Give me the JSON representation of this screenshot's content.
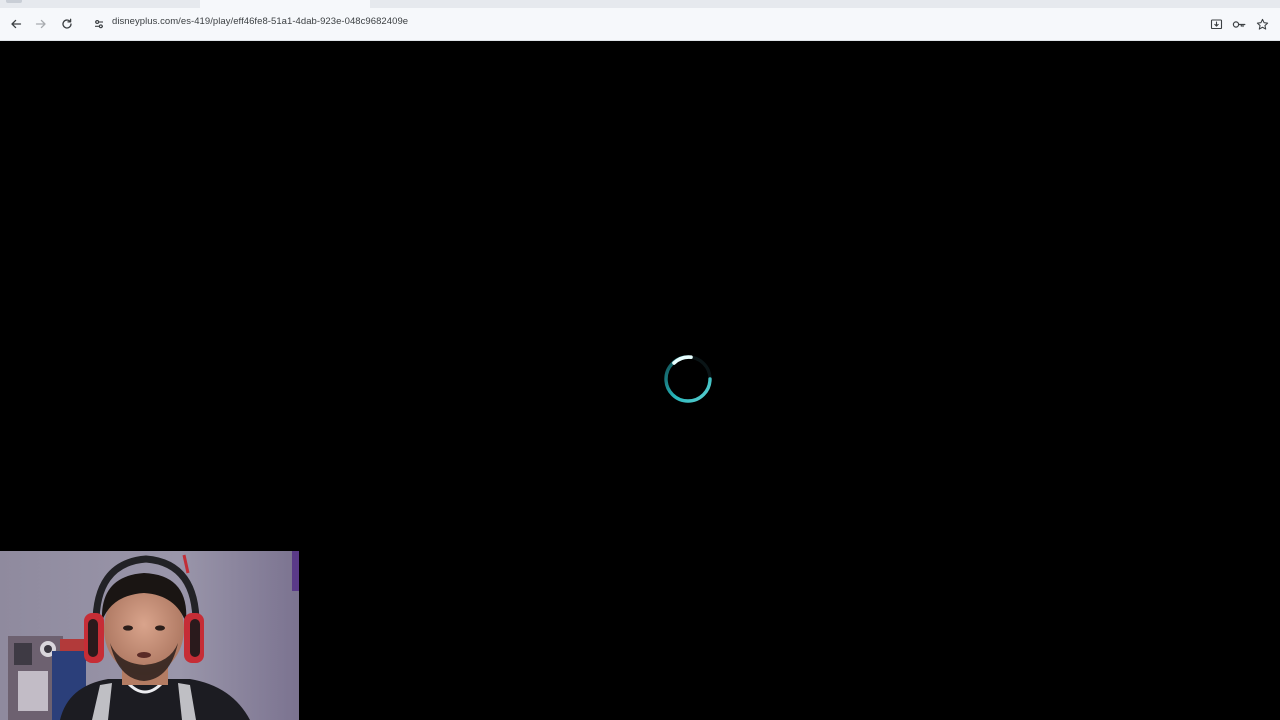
{
  "browser": {
    "url": "disneyplus.com/es-419/play/eff46fe8-51a1-4dab-923e-048c9682409e",
    "nav": {
      "back_icon": "arrow-left-icon",
      "forward_icon": "arrow-right-icon",
      "reload_icon": "reload-icon",
      "site_info_icon": "tune-icon"
    },
    "toolbar_right": {
      "install_icon": "install-app-icon",
      "password_icon": "key-icon",
      "bookmark_icon": "star-icon"
    }
  },
  "player": {
    "state": "loading",
    "spinner_icon": "loading-spinner-icon",
    "accent_color": "#2bd3d8",
    "background_color": "#000000"
  },
  "overlay": {
    "webcam": "webcam-feed"
  }
}
